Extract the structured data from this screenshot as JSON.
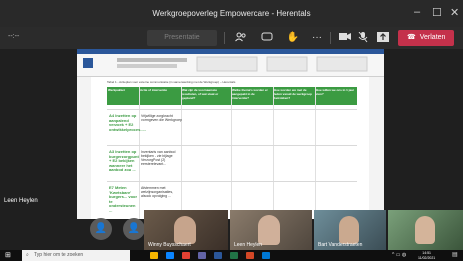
{
  "window": {
    "title": "Werkgroepoverleg Empowercare - Herentals"
  },
  "toolbar": {
    "timer": "--:--",
    "stop_sharing": "Presentatie beëindigen",
    "leave": "Verlaten",
    "leave_color": "#c4314b"
  },
  "shared_screen": {
    "doc_heading": "Tabel 1 - Actieplan voor externe communicatie (in samenwerking met de Werkgroep) – Herentals",
    "headers": [
      "Werkpakket",
      "Actie of interventie",
      "Wat zijn de voornaamste resultaten, of wat staat er gepland?",
      "Welke thema's worden er aangepakt in de interventie?",
      "Hoe worden we met de leden vanuit de werkgroep betrokken?",
      "Hoe willen we ons in 1 jaar zien?"
    ],
    "rows": [
      {
        "label": "A4 Inzetten op aanpalend verzoek + E2 ontwikkelproces.....",
        "text": "Vrijwillige zorgkracht vormgeven die Werkgroep"
      },
      {
        "label": "A3 Inzetten op burgerzorgpunt + E2 bekijken wanneer het aanbod zou ...",
        "text": "Inventaris van aanbod bekijken - zie bijlage VerzorgPost (2) eersterelevant..."
      },
      {
        "label": "E7 Meten 'Kwetsbare' burgers... voor te ondersteunen ...",
        "text": "Afstemmen met welzijnsorganisaties, alsook opvolging ..."
      }
    ]
  },
  "participants": {
    "self_name": "Leen Heylen",
    "tiles": [
      {
        "name": "Winny Buysschaert"
      },
      {
        "name": "Leen Heylen"
      },
      {
        "name": "Bart Vanderstraeten"
      },
      {
        "name": ""
      }
    ]
  },
  "taskbar": {
    "search_placeholder": "Typ hier om te zoeken",
    "time": "14:51",
    "date": "11/02/2021"
  }
}
